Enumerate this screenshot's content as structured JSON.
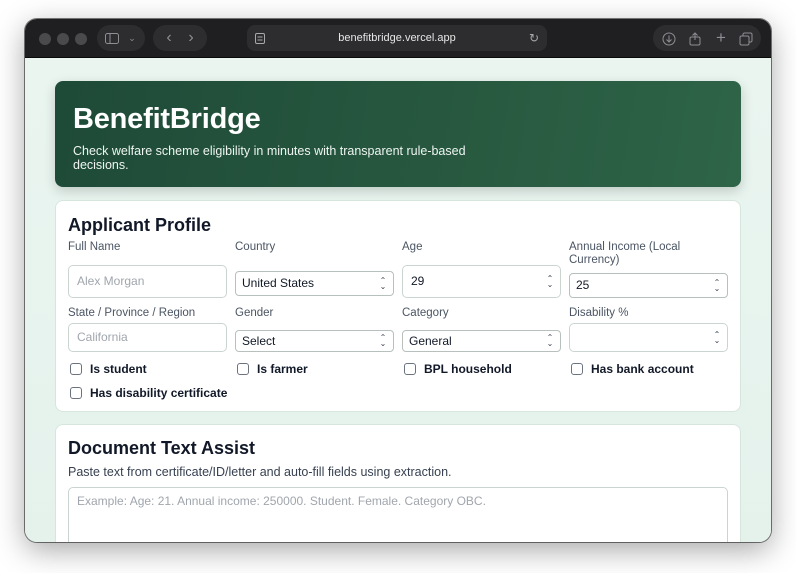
{
  "browser": {
    "url": "benefitbridge.vercel.app",
    "icons": [
      "sidebar-icon",
      "chevron-down-icon",
      "back-icon",
      "forward-icon",
      "page-icon",
      "reload-icon",
      "download-icon",
      "share-icon",
      "new-tab-icon",
      "tabs-icon"
    ]
  },
  "hero": {
    "title": "BenefitBridge",
    "subtitle": "Check welfare scheme eligibility in minutes with transparent rule-based decisions."
  },
  "profile": {
    "heading": "Applicant Profile",
    "full_name": {
      "label": "Full Name",
      "placeholder": "Alex Morgan",
      "value": ""
    },
    "country": {
      "label": "Country",
      "value": "United States"
    },
    "age": {
      "label": "Age",
      "value": "29"
    },
    "income": {
      "label": "Annual Income (Local Currency)",
      "value": "25"
    },
    "state": {
      "label": "State / Province / Region",
      "placeholder": "California",
      "value": ""
    },
    "gender": {
      "label": "Gender",
      "value": "Select"
    },
    "category": {
      "label": "Category",
      "value": "General"
    },
    "disability": {
      "label": "Disability %",
      "value": ""
    },
    "checkboxes": {
      "student": "Is student",
      "farmer": "Is farmer",
      "bpl": "BPL household",
      "bank": "Has bank account",
      "disability_cert": "Has disability certificate"
    }
  },
  "document": {
    "heading": "Document Text Assist",
    "description": "Paste text from certificate/ID/letter and auto-fill fields using extraction.",
    "placeholder": "Example: Age: 21. Annual income: 250000. Student. Female. Category OBC."
  },
  "colors": {
    "hero_bg": "#1e4a38",
    "page_bg": "#e8f4ee",
    "titlebar": "#1f1f21"
  }
}
